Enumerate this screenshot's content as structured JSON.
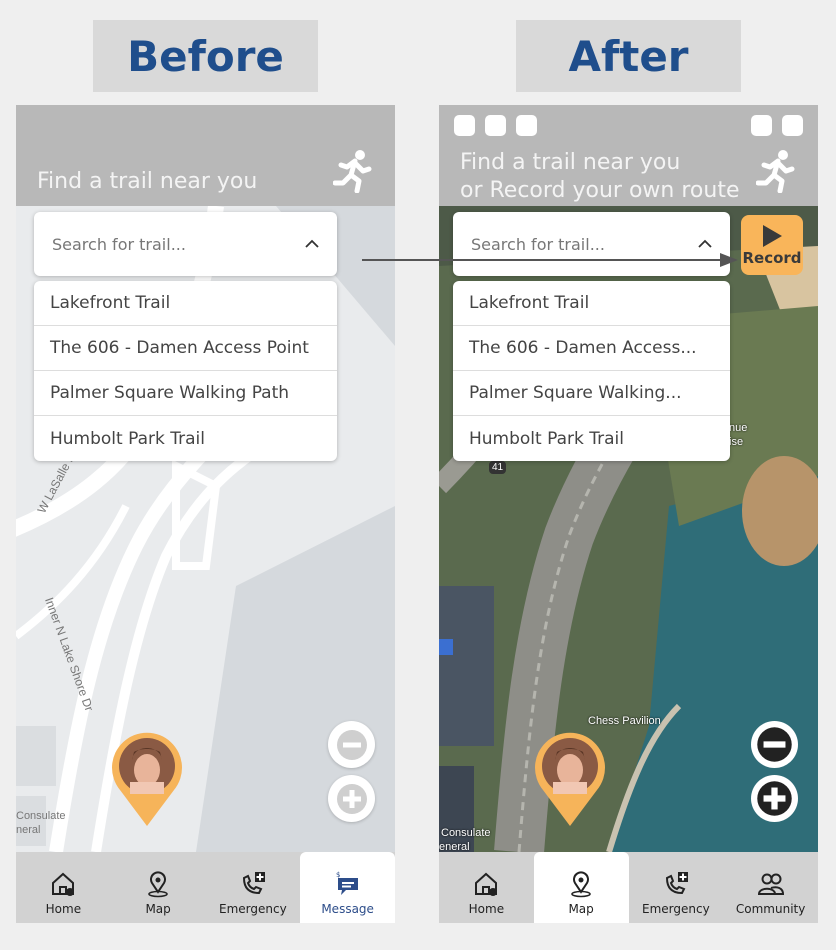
{
  "labels": {
    "before": "Before",
    "after": "After"
  },
  "before": {
    "header_title": "Find a trail near you",
    "search_placeholder": "Search for trail...",
    "trails": [
      "Lakefront Trail",
      "The 606 - Damen Access Point",
      "Palmer Square Walking Path",
      "Humbolt Park Trail"
    ],
    "map_labels": {
      "street1": "W LaSalle Dr",
      "street2": "Inner N Lake Shore Dr",
      "place": "Consulate",
      "place2": "neral"
    },
    "nav": [
      "Home",
      "Map",
      "Emergency",
      "Message"
    ],
    "active_tab": "Message"
  },
  "after": {
    "header_title_line1": "Find a trail near you",
    "header_title_line2": "or Record your own route",
    "search_placeholder": "Search for trail...",
    "trails": [
      "Lakefront Trail",
      "The 606 - Damen Access...",
      "Palmer Square Walking...",
      "Humbolt Park Trail"
    ],
    "record_label": "Record",
    "map_labels": {
      "pavilion": "Chess Pavilion",
      "route": "41",
      "place": "Consulate",
      "place2": "eneral",
      "beach": "nue",
      "beach2": "ise"
    },
    "nav": [
      "Home",
      "Map",
      "Emergency",
      "Community"
    ],
    "active_tab": "Map"
  },
  "colors": {
    "title_blue": "#1f4e8c",
    "record_orange": "#f9b55a",
    "header_gray": "#b8b8b8"
  }
}
